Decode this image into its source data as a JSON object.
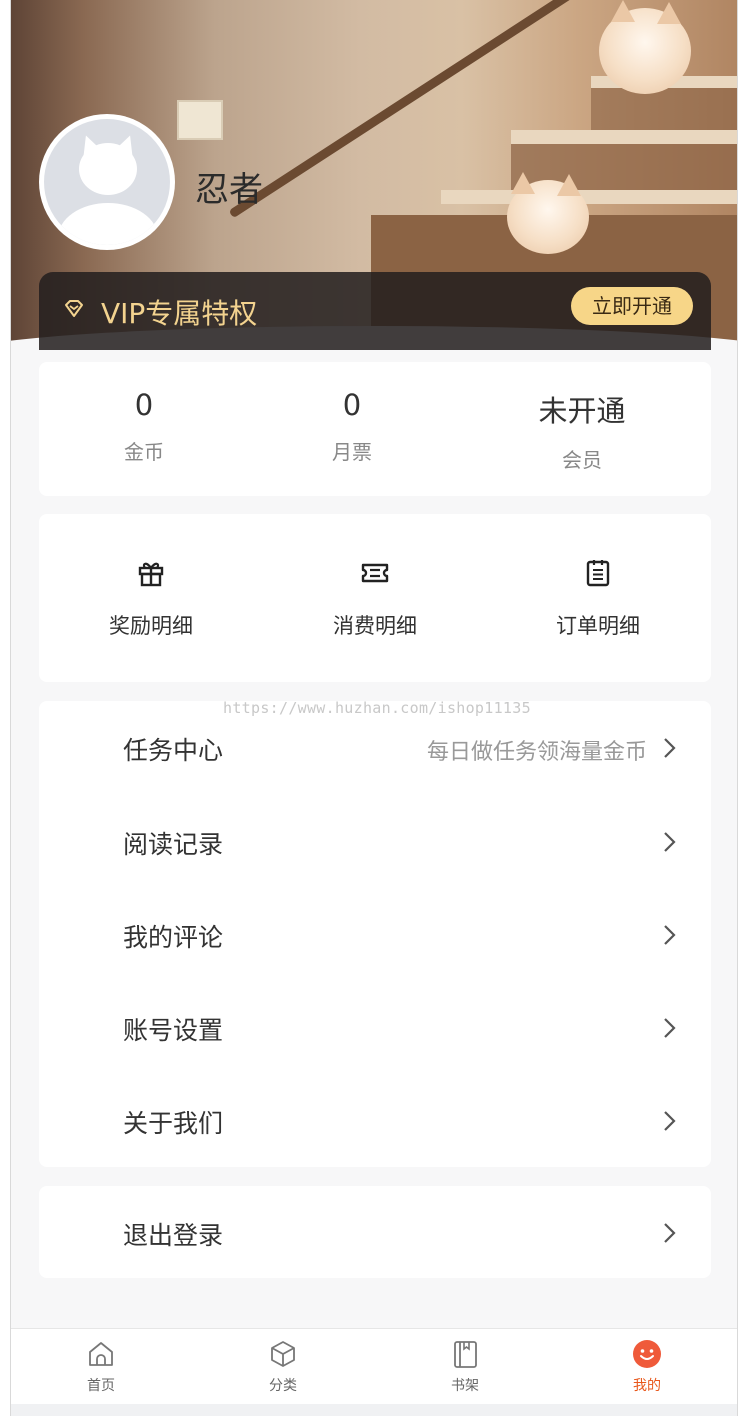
{
  "profile": {
    "username": "忍者"
  },
  "vip": {
    "title": "VIP专属特权",
    "button": "立即开通"
  },
  "stats": [
    {
      "value": "0",
      "label": "金币"
    },
    {
      "value": "0",
      "label": "月票"
    },
    {
      "value": "未开通",
      "label": "会员"
    }
  ],
  "actions": [
    {
      "label": "奖励明细",
      "icon": "gift-icon"
    },
    {
      "label": "消费明细",
      "icon": "ticket-icon"
    },
    {
      "label": "订单明细",
      "icon": "clipboard-icon"
    }
  ],
  "menu": [
    {
      "label": "任务中心",
      "hint": "每日做任务领海量金币"
    },
    {
      "label": "阅读记录",
      "hint": ""
    },
    {
      "label": "我的评论",
      "hint": ""
    },
    {
      "label": "账号设置",
      "hint": ""
    },
    {
      "label": "关于我们",
      "hint": ""
    }
  ],
  "logout": {
    "label": "退出登录"
  },
  "watermark": "https://www.huzhan.com/ishop11135",
  "tabbar": [
    {
      "label": "首页",
      "icon": "home-icon",
      "active": false
    },
    {
      "label": "分类",
      "icon": "cube-icon",
      "active": false
    },
    {
      "label": "书架",
      "icon": "book-icon",
      "active": false
    },
    {
      "label": "我的",
      "icon": "smile-icon",
      "active": true
    }
  ],
  "colors": {
    "accent": "#e8571b",
    "vip_gold": "#f3d38f",
    "vip_button": "#f7d688"
  }
}
